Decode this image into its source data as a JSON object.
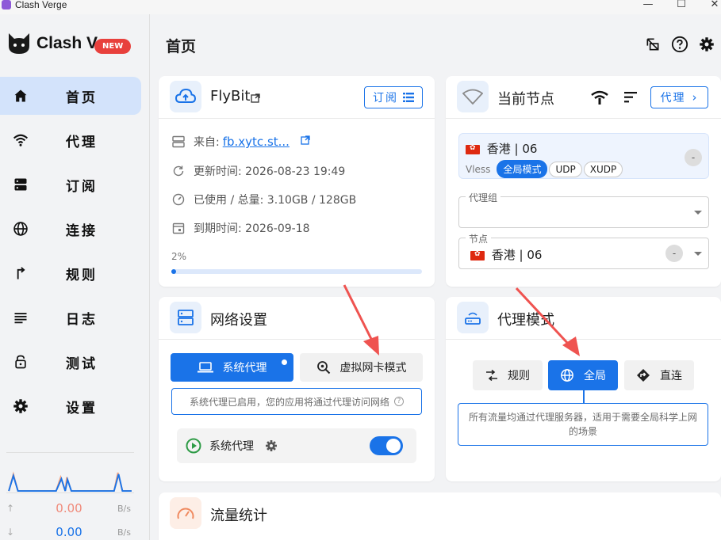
{
  "window": {
    "title": "Clash Verge",
    "min": "—",
    "max": "☐",
    "close": "✕"
  },
  "brand": {
    "name": "Clash V",
    "badge": "NEW"
  },
  "nav": [
    {
      "label": "首页",
      "icon": "home-icon",
      "active": true
    },
    {
      "label": "代理",
      "icon": "wifi-icon"
    },
    {
      "label": "订阅",
      "icon": "subscription-icon"
    },
    {
      "label": "连接",
      "icon": "globe-icon"
    },
    {
      "label": "规则",
      "icon": "rules-icon"
    },
    {
      "label": "日志",
      "icon": "log-icon"
    },
    {
      "label": "测试",
      "icon": "lock-icon"
    },
    {
      "label": "设置",
      "icon": "gear-icon"
    }
  ],
  "traffic_mini": {
    "up_value": "0.00",
    "up_unit": "B/s",
    "down_value": "0.00",
    "down_unit": "B/s"
  },
  "header": {
    "title": "首页"
  },
  "profile": {
    "name": "FlyBit",
    "subscribe_label": "订阅",
    "from_label": "来自:",
    "from_link": "fb.xytc.st...",
    "updated": "更新时间: 2026-08-23 19:49",
    "usage": "已使用 / 总量: 3.10GB / 128GB",
    "expire": "到期时间: 2026-09-18",
    "progress_label": "2%",
    "progress": 0.02
  },
  "current_node": {
    "title": "当前节点",
    "proxy_button": "代理",
    "node_name": "香港 | 06",
    "protocol": "Vless",
    "chips": [
      "全局模式",
      "UDP",
      "XUDP"
    ],
    "delay": "-",
    "group_legend": "代理组",
    "node_legend": "节点",
    "node_select_value": "香港 | 06",
    "node_select_delay": "-"
  },
  "network": {
    "title": "网络设置",
    "tab_system": "系统代理",
    "tab_tun": "虚拟网卡模式",
    "note": "系统代理已启用，您的应用将通过代理访问网络",
    "toggle_label": "系统代理",
    "toggle_on": true
  },
  "proxy_mode": {
    "title": "代理模式",
    "modes": [
      "规则",
      "全局",
      "直连"
    ],
    "active": "全局",
    "note": "所有流量均通过代理服务器，适用于需要全局科学上网的场景"
  },
  "traffic": {
    "title": "流量统计"
  },
  "colors": {
    "accent": "#1a73e8",
    "annotation": "#ef5350",
    "new_badge": "#e8403c"
  }
}
